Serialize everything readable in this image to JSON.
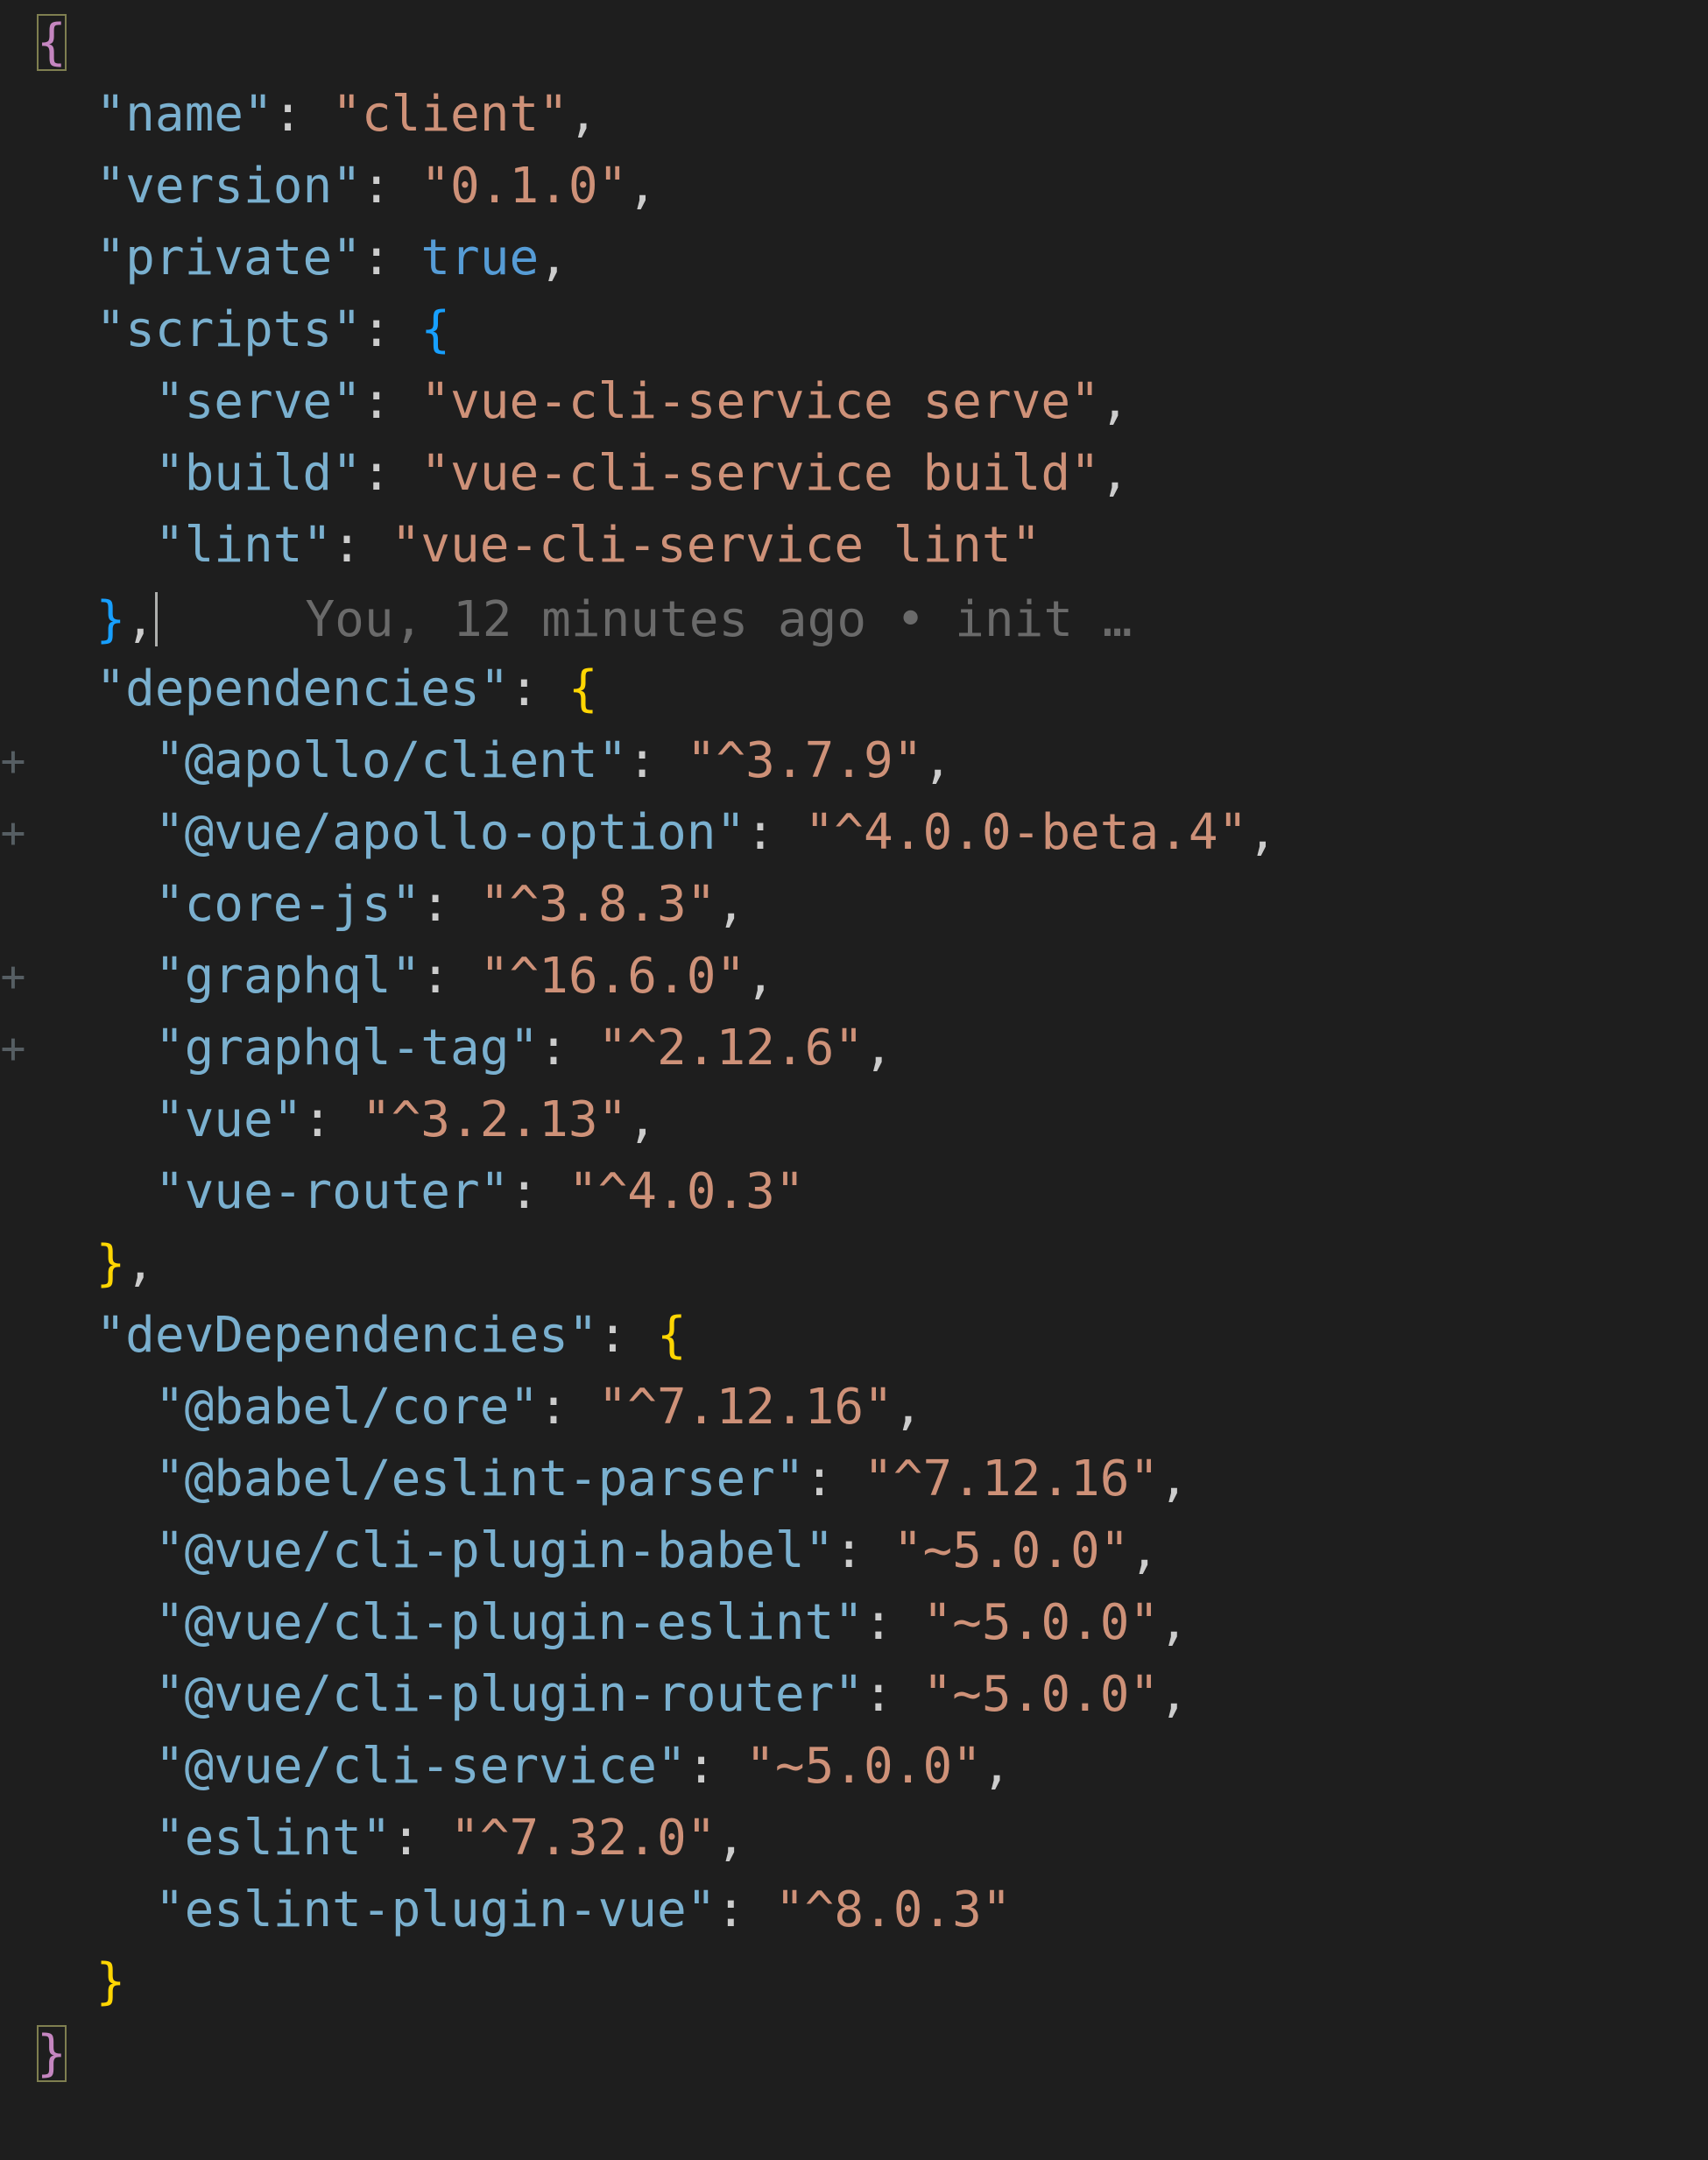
{
  "blame": "You, 12 minutes ago • init …",
  "lines": [
    {
      "indent": 0,
      "tokens": [
        {
          "t": "{",
          "c": "br",
          "match": true
        }
      ]
    },
    {
      "indent": 1,
      "tokens": [
        {
          "t": "\"name\"",
          "c": "k"
        },
        {
          "t": ": ",
          "c": "p"
        },
        {
          "t": "\"client\"",
          "c": "s"
        },
        {
          "t": ",",
          "c": "p"
        }
      ]
    },
    {
      "indent": 1,
      "tokens": [
        {
          "t": "\"version\"",
          "c": "k"
        },
        {
          "t": ": ",
          "c": "p"
        },
        {
          "t": "\"0.1.0\"",
          "c": "s"
        },
        {
          "t": ",",
          "c": "p"
        }
      ]
    },
    {
      "indent": 1,
      "tokens": [
        {
          "t": "\"private\"",
          "c": "k"
        },
        {
          "t": ": ",
          "c": "p"
        },
        {
          "t": "true",
          "c": "kw"
        },
        {
          "t": ",",
          "c": "p"
        }
      ]
    },
    {
      "indent": 1,
      "tokens": [
        {
          "t": "\"scripts\"",
          "c": "k"
        },
        {
          "t": ": ",
          "c": "p"
        },
        {
          "t": "{",
          "c": "brk"
        }
      ]
    },
    {
      "indent": 2,
      "tokens": [
        {
          "t": "\"serve\"",
          "c": "k"
        },
        {
          "t": ": ",
          "c": "p"
        },
        {
          "t": "\"vue-cli-service serve\"",
          "c": "s"
        },
        {
          "t": ",",
          "c": "p"
        }
      ]
    },
    {
      "indent": 2,
      "tokens": [
        {
          "t": "\"build\"",
          "c": "k"
        },
        {
          "t": ": ",
          "c": "p"
        },
        {
          "t": "\"vue-cli-service build\"",
          "c": "s"
        },
        {
          "t": ",",
          "c": "p"
        }
      ]
    },
    {
      "indent": 2,
      "tokens": [
        {
          "t": "\"lint\"",
          "c": "k"
        },
        {
          "t": ": ",
          "c": "p"
        },
        {
          "t": "\"vue-cli-service lint\"",
          "c": "s"
        }
      ]
    },
    {
      "indent": 1,
      "cursor": true,
      "tokens": [
        {
          "t": "}",
          "c": "brk"
        },
        {
          "t": ",",
          "c": "p"
        }
      ],
      "blame": true
    },
    {
      "indent": 1,
      "tokens": [
        {
          "t": "\"dependencies\"",
          "c": "k"
        },
        {
          "t": ": ",
          "c": "p"
        },
        {
          "t": "{",
          "c": "bry"
        }
      ]
    },
    {
      "indent": 2,
      "diff": "+",
      "tokens": [
        {
          "t": "\"@apollo/client\"",
          "c": "k"
        },
        {
          "t": ": ",
          "c": "p"
        },
        {
          "t": "\"^3.7.9\"",
          "c": "s"
        },
        {
          "t": ",",
          "c": "p"
        }
      ]
    },
    {
      "indent": 2,
      "diff": "+",
      "tokens": [
        {
          "t": "\"@vue/apollo-option\"",
          "c": "k"
        },
        {
          "t": ": ",
          "c": "p"
        },
        {
          "t": "\"^4.0.0-beta.4\"",
          "c": "s"
        },
        {
          "t": ",",
          "c": "p"
        }
      ]
    },
    {
      "indent": 2,
      "tokens": [
        {
          "t": "\"core-js\"",
          "c": "k"
        },
        {
          "t": ": ",
          "c": "p"
        },
        {
          "t": "\"^3.8.3\"",
          "c": "s"
        },
        {
          "t": ",",
          "c": "p"
        }
      ]
    },
    {
      "indent": 2,
      "diff": "+",
      "tokens": [
        {
          "t": "\"graphql\"",
          "c": "k"
        },
        {
          "t": ": ",
          "c": "p"
        },
        {
          "t": "\"^16.6.0\"",
          "c": "s"
        },
        {
          "t": ",",
          "c": "p"
        }
      ]
    },
    {
      "indent": 2,
      "diff": "+",
      "tokens": [
        {
          "t": "\"graphql-tag\"",
          "c": "k"
        },
        {
          "t": ": ",
          "c": "p"
        },
        {
          "t": "\"^2.12.6\"",
          "c": "s"
        },
        {
          "t": ",",
          "c": "p"
        }
      ]
    },
    {
      "indent": 2,
      "tokens": [
        {
          "t": "\"vue\"",
          "c": "k"
        },
        {
          "t": ": ",
          "c": "p"
        },
        {
          "t": "\"^3.2.13\"",
          "c": "s"
        },
        {
          "t": ",",
          "c": "p"
        }
      ]
    },
    {
      "indent": 2,
      "tokens": [
        {
          "t": "\"vue-router\"",
          "c": "k"
        },
        {
          "t": ": ",
          "c": "p"
        },
        {
          "t": "\"^4.0.3\"",
          "c": "s"
        }
      ]
    },
    {
      "indent": 1,
      "tokens": [
        {
          "t": "}",
          "c": "bry"
        },
        {
          "t": ",",
          "c": "p"
        }
      ]
    },
    {
      "indent": 1,
      "tokens": [
        {
          "t": "\"devDependencies\"",
          "c": "k"
        },
        {
          "t": ": ",
          "c": "p"
        },
        {
          "t": "{",
          "c": "bry"
        }
      ]
    },
    {
      "indent": 2,
      "tokens": [
        {
          "t": "\"@babel/core\"",
          "c": "k"
        },
        {
          "t": ": ",
          "c": "p"
        },
        {
          "t": "\"^7.12.16\"",
          "c": "s"
        },
        {
          "t": ",",
          "c": "p"
        }
      ]
    },
    {
      "indent": 2,
      "tokens": [
        {
          "t": "\"@babel/eslint-parser\"",
          "c": "k"
        },
        {
          "t": ": ",
          "c": "p"
        },
        {
          "t": "\"^7.12.16\"",
          "c": "s"
        },
        {
          "t": ",",
          "c": "p"
        }
      ]
    },
    {
      "indent": 2,
      "tokens": [
        {
          "t": "\"@vue/cli-plugin-babel\"",
          "c": "k"
        },
        {
          "t": ": ",
          "c": "p"
        },
        {
          "t": "\"~5.0.0\"",
          "c": "s"
        },
        {
          "t": ",",
          "c": "p"
        }
      ]
    },
    {
      "indent": 2,
      "tokens": [
        {
          "t": "\"@vue/cli-plugin-eslint\"",
          "c": "k"
        },
        {
          "t": ": ",
          "c": "p"
        },
        {
          "t": "\"~5.0.0\"",
          "c": "s"
        },
        {
          "t": ",",
          "c": "p"
        }
      ]
    },
    {
      "indent": 2,
      "tokens": [
        {
          "t": "\"@vue/cli-plugin-router\"",
          "c": "k"
        },
        {
          "t": ": ",
          "c": "p"
        },
        {
          "t": "\"~5.0.0\"",
          "c": "s"
        },
        {
          "t": ",",
          "c": "p"
        }
      ]
    },
    {
      "indent": 2,
      "tokens": [
        {
          "t": "\"@vue/cli-service\"",
          "c": "k"
        },
        {
          "t": ": ",
          "c": "p"
        },
        {
          "t": "\"~5.0.0\"",
          "c": "s"
        },
        {
          "t": ",",
          "c": "p"
        }
      ]
    },
    {
      "indent": 2,
      "tokens": [
        {
          "t": "\"eslint\"",
          "c": "k"
        },
        {
          "t": ": ",
          "c": "p"
        },
        {
          "t": "\"^7.32.0\"",
          "c": "s"
        },
        {
          "t": ",",
          "c": "p"
        }
      ]
    },
    {
      "indent": 2,
      "tokens": [
        {
          "t": "\"eslint-plugin-vue\"",
          "c": "k"
        },
        {
          "t": ": ",
          "c": "p"
        },
        {
          "t": "\"^8.0.3\"",
          "c": "s"
        }
      ]
    },
    {
      "indent": 1,
      "tokens": [
        {
          "t": "}",
          "c": "bry"
        }
      ]
    },
    {
      "indent": 0,
      "tokens": [
        {
          "t": "}",
          "c": "br",
          "match": true
        }
      ]
    }
  ]
}
